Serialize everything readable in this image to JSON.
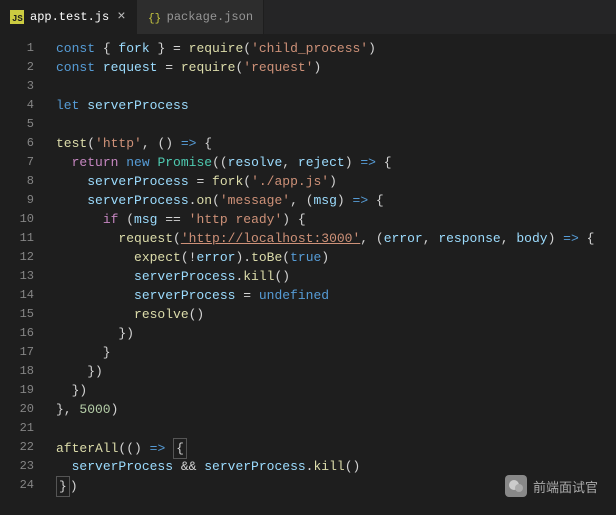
{
  "tabs": [
    {
      "label": "app.test.js",
      "icon": "js",
      "active": true
    },
    {
      "label": "package.json",
      "icon": "json",
      "active": false
    }
  ],
  "watermark": "前端面试官",
  "code": {
    "lines": 24,
    "tokens": {
      "const": "const",
      "let": "let",
      "return": "return",
      "new": "new",
      "if": "if",
      "fork": "fork",
      "require": "require",
      "request": "request",
      "serverProcess": "serverProcess",
      "test": "test",
      "Promise": "Promise",
      "resolve": "resolve",
      "reject": "reject",
      "on": "on",
      "msg": "msg",
      "expect": "expect",
      "error": "error",
      "response": "response",
      "body": "body",
      "toBe": "toBe",
      "kill": "kill",
      "undefined": "undefined",
      "afterAll": "afterAll",
      "true": "true"
    },
    "strings": {
      "child_process": "'child_process'",
      "request_mod": "'request'",
      "http": "'http'",
      "appjs": "'./app.js'",
      "message": "'message'",
      "http_ready": "'http ready'",
      "url": "'http://localhost:3000'"
    },
    "numbers": {
      "timeout": "5000"
    }
  }
}
